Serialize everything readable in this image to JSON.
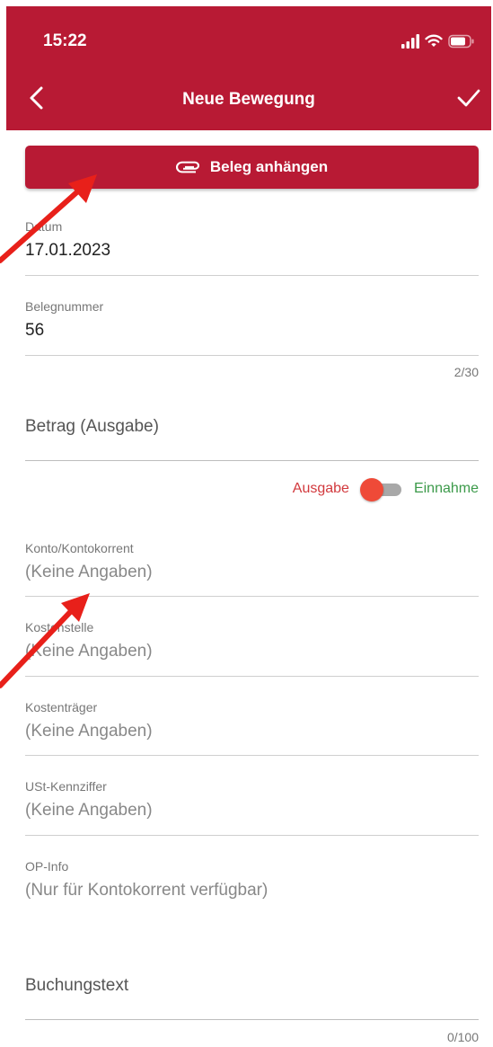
{
  "status_bar": {
    "time": "15:22"
  },
  "header": {
    "title": "Neue Bewegung",
    "back_icon": "chevron-left-icon",
    "confirm_icon": "checkmark-icon",
    "color": "#b81a34"
  },
  "attach_button": {
    "label": "Beleg anhängen",
    "icon": "paperclip-icon"
  },
  "form": {
    "datum": {
      "label": "Datum",
      "value": "17.01.2023"
    },
    "belegnummer": {
      "label": "Belegnummer",
      "value": "56",
      "counter": "2/30"
    },
    "betrag": {
      "placeholder": "Betrag (Ausgabe)"
    },
    "type_toggle": {
      "left_label": "Ausgabe",
      "right_label": "Einnahme",
      "selected": "Ausgabe",
      "left_color": "#d2393d",
      "right_color": "#3c9a4a"
    },
    "konto": {
      "label": "Konto/Kontokorrent",
      "value": "(Keine Angaben)"
    },
    "kostenstelle": {
      "label": "Kostenstelle",
      "value": "(Keine Angaben)"
    },
    "kostentraeger": {
      "label": "Kostenträger",
      "value": "(Keine Angaben)"
    },
    "ust": {
      "label": "USt-Kennziffer",
      "value": "(Keine Angaben)"
    },
    "op_info": {
      "label": "OP-Info",
      "value": "(Nur für Kontokorrent verfügbar)"
    },
    "buchungstext": {
      "placeholder": "Buchungstext",
      "counter": "0/100"
    }
  },
  "annotations": {
    "arrow_color": "#e8201a"
  }
}
